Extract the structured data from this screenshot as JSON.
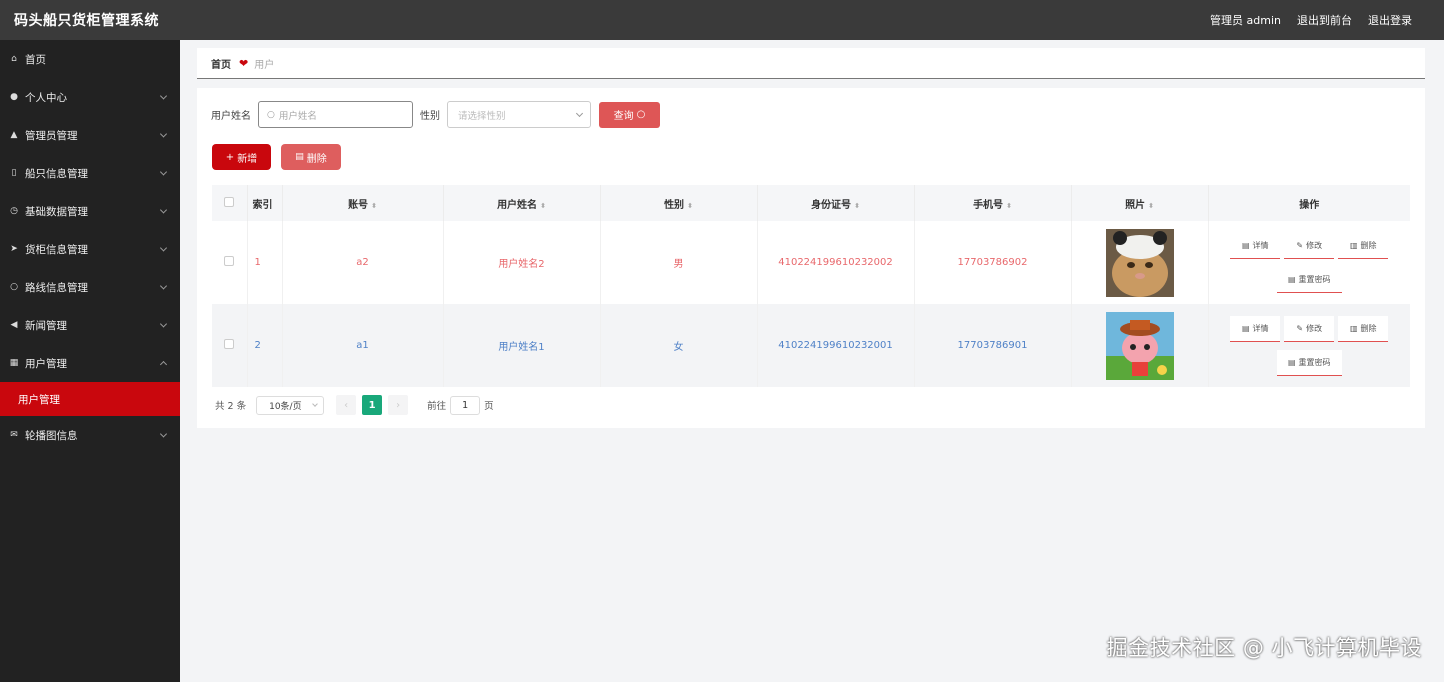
{
  "app": {
    "title": "码头船只货柜管理系统"
  },
  "topbar": {
    "admin_label": "管理员 admin",
    "front_label": "退出到前台",
    "logout_label": "退出登录"
  },
  "sidebar": {
    "items": [
      {
        "label": "首页",
        "icon": "home-icon"
      },
      {
        "label": "个人中心",
        "icon": "user-icon"
      },
      {
        "label": "管理员管理",
        "icon": "admin-icon"
      },
      {
        "label": "船只信息管理",
        "icon": "ship-icon"
      },
      {
        "label": "基础数据管理",
        "icon": "clock-icon"
      },
      {
        "label": "货柜信息管理",
        "icon": "send-icon"
      },
      {
        "label": "路线信息管理",
        "icon": "circle-icon"
      },
      {
        "label": "新闻管理",
        "icon": "news-icon"
      },
      {
        "label": "用户管理",
        "icon": "grid-icon"
      },
      {
        "label": "轮播图信息",
        "icon": "mail-icon"
      }
    ],
    "active_sub": "用户管理"
  },
  "breadcrumb": {
    "home": "首页",
    "current": "用户"
  },
  "search": {
    "name_label": "用户姓名",
    "name_placeholder": "用户姓名",
    "gender_label": "性别",
    "gender_placeholder": "请选择性别",
    "query_label": "查询"
  },
  "actions": {
    "add_label": "新增",
    "delete_label": "删除"
  },
  "table": {
    "headers": [
      "索引",
      "账号",
      "用户姓名",
      "性别",
      "身份证号",
      "手机号",
      "照片",
      "操作"
    ],
    "rows": [
      {
        "index": "1",
        "account": "a2",
        "name": "用户姓名2",
        "gender": "男",
        "id_card": "410224199610232002",
        "phone": "17703786902"
      },
      {
        "index": "2",
        "account": "a1",
        "name": "用户姓名1",
        "gender": "女",
        "id_card": "410224199610232001",
        "phone": "17703786901"
      }
    ],
    "ops": {
      "detail": "详情",
      "edit": "修改",
      "delete": "删除",
      "reset": "重置密码"
    }
  },
  "pager": {
    "total": "共 2 条",
    "page_size": "10条/页",
    "current_page": "1",
    "goto_label": "前往",
    "goto_value": "1",
    "page_suffix": "页"
  },
  "watermark": "掘金技术社区 @ 小飞计算机毕设",
  "colors": {
    "topbar": "#3a3a3a",
    "sidebar": "#222222",
    "accent": "#c9070d",
    "pager_active": "#19a87a"
  }
}
